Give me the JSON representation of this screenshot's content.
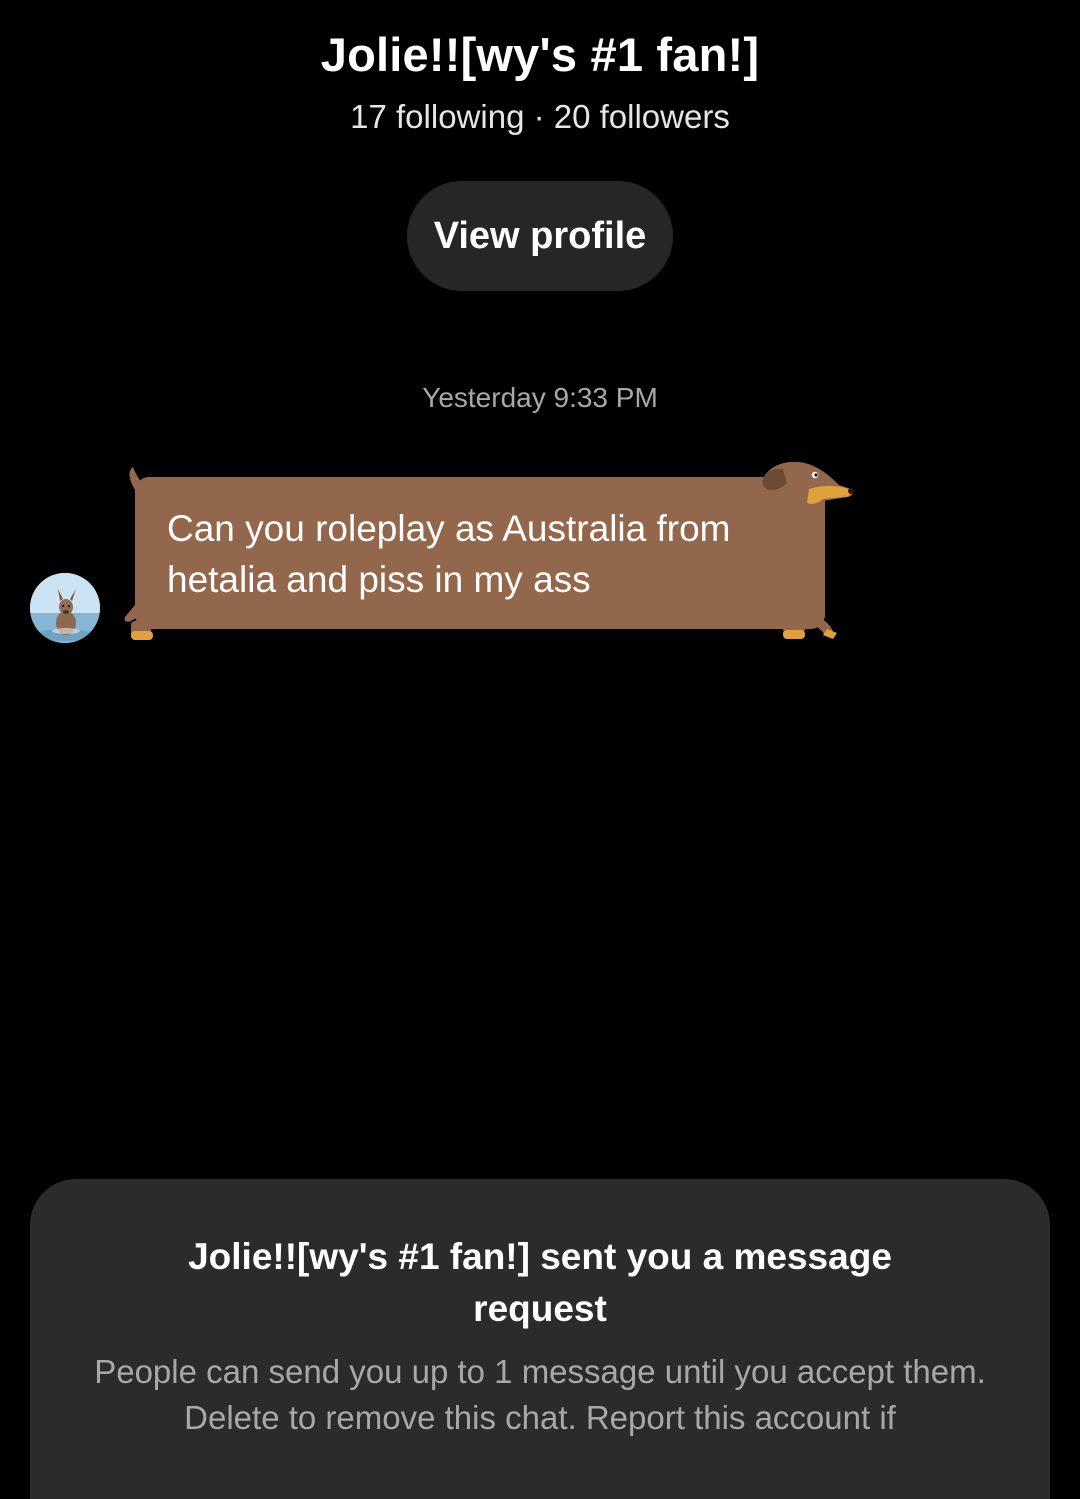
{
  "header": {
    "name": "Jolie!![wy's #1 fan!]",
    "stats": "17 following · 20 followers",
    "view_profile_label": "View profile"
  },
  "thread": {
    "timestamp": "Yesterday 9:33 PM",
    "messages": [
      {
        "text": "Can you roleplay as Australia from hetalia and piss in my ass",
        "bubble_style": "dachshund-bubble",
        "bubble_color": "#93674c"
      }
    ]
  },
  "request": {
    "title": "Jolie!![wy's #1 fan!] sent you a message request",
    "body": "People can send you up to 1 message until you accept them. Delete to remove this chat. Report this account if"
  },
  "colors": {
    "background": "#000000",
    "button_bg": "#262626",
    "panel_bg": "#2b2b2b",
    "muted_text": "#a8a8a8",
    "dog_brown": "#93674c",
    "dog_tan": "#e0a03c"
  },
  "icons": {
    "avatar": "kangaroo-avatar",
    "bubble": "dachshund-bubble"
  }
}
